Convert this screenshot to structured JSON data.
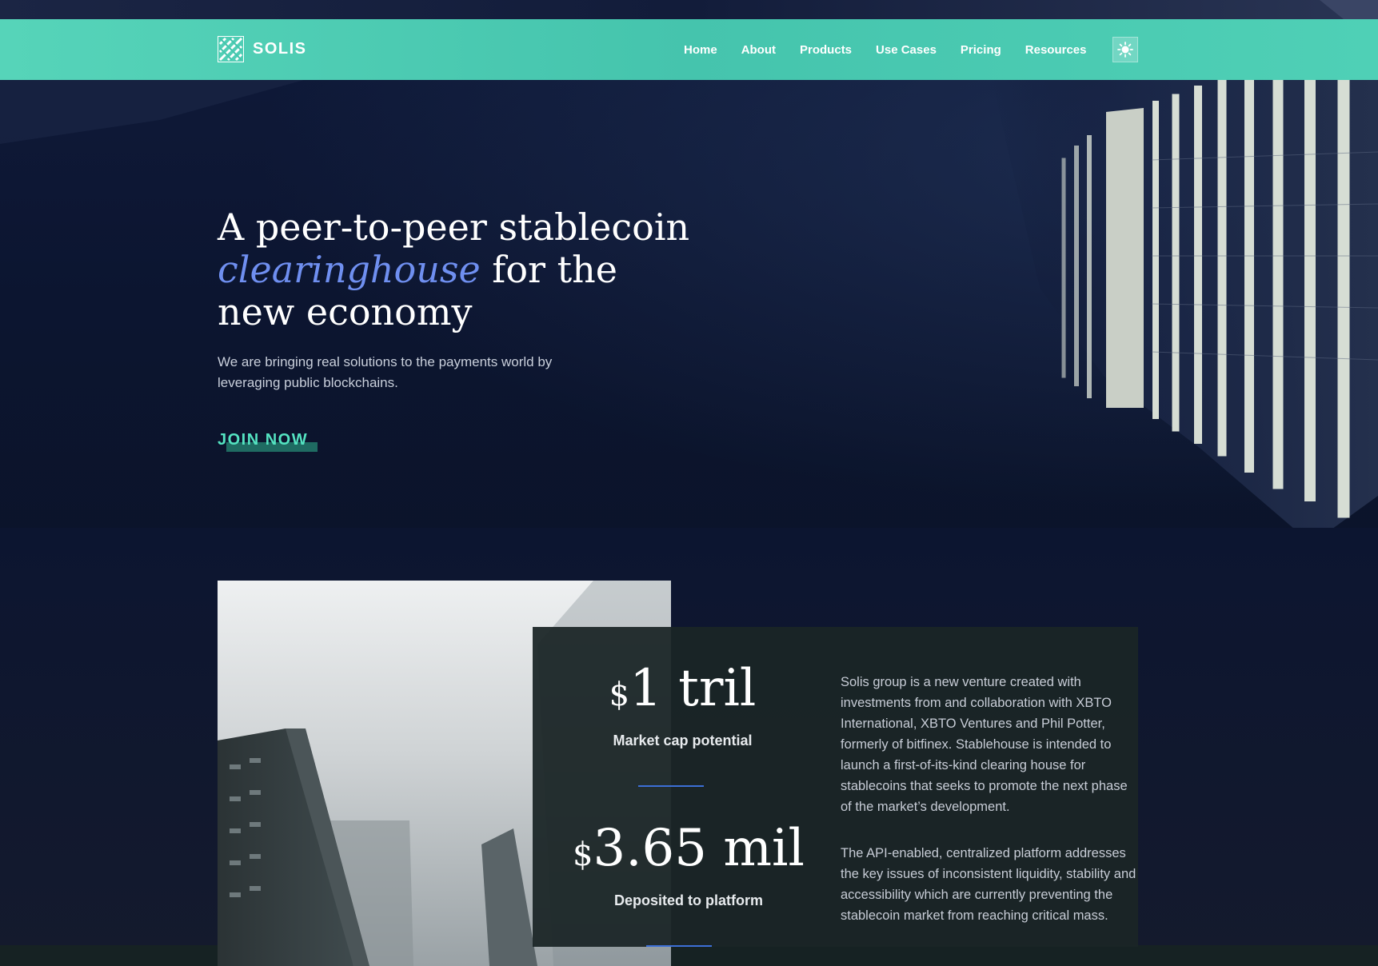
{
  "nav": {
    "brand": "SOLIS",
    "links": [
      "Home",
      "About",
      "Products",
      "Use Cases",
      "Pricing",
      "Resources"
    ]
  },
  "hero": {
    "title_before": "A peer-to-peer stablecoin",
    "title_accent": "clearinghouse",
    "title_after": "for the new economy",
    "subtitle": "We are bringing real solutions to the payments world by leveraging public blockchains.",
    "cta": "JOIN NOW"
  },
  "stats": [
    {
      "currency": "$",
      "value": "1 tril",
      "label": "Market cap potential"
    },
    {
      "currency": "$",
      "value": "3.65 mil",
      "label": "Deposited to platform"
    }
  ],
  "about": {
    "paragraphs": [
      "Solis group is a new venture created with investments from and collaboration with XBTO International, XBTO Ventures and Phil Potter, formerly of bitfinex. Stablehouse is intended to launch a first-of-its-kind clearing house for stablecoins that seeks to promote the next phase of the market’s development.",
      "The API-enabled, centralized platform addresses the key issues of inconsistent liquidity, stability and accessibility which are currently preventing the stablecoin market from reaching critical mass."
    ]
  },
  "colors": {
    "nav_bg": "#45c4ad",
    "page_bg": "#0c1530",
    "accent_blue": "#6f8ff0",
    "cta_green": "#54e3c1",
    "card_bg": "#1b2526"
  },
  "icons": {
    "logo": "woven-square-logo-icon",
    "theme_toggle": "sun-icon"
  }
}
